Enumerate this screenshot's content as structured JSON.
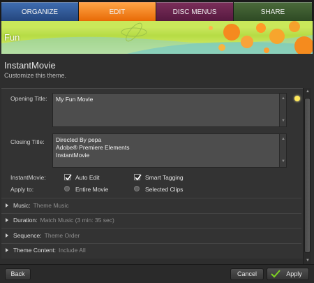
{
  "tabs": [
    "ORGANIZE",
    "EDIT",
    "DISC MENUS",
    "SHARE"
  ],
  "banner": {
    "title": "Fun"
  },
  "theme": {
    "name": "InstantMovie",
    "subtitle": "Customize this theme."
  },
  "opening_title": {
    "label": "Opening Title:",
    "value": "My Fun Movie"
  },
  "closing_title": {
    "label": "Closing Title:",
    "lines": [
      "Directed By pepa",
      "Adobe® Premiere Elements",
      "InstantMovie"
    ]
  },
  "instantmovie": {
    "label": "InstantMovie:",
    "auto_edit": {
      "label": "Auto Edit",
      "checked": true
    },
    "smart_tagging": {
      "label": "Smart Tagging",
      "checked": true
    }
  },
  "apply_to": {
    "label": "Apply to:",
    "entire_movie": "Entire Movie",
    "selected_clips": "Selected Clips"
  },
  "sections": [
    {
      "name": "Music:",
      "value": "Theme Music"
    },
    {
      "name": "Duration:",
      "value": "Match Music (3 min: 35 sec)"
    },
    {
      "name": "Sequence:",
      "value": "Theme Order"
    },
    {
      "name": "Theme Content:",
      "value": "Include All"
    }
  ],
  "footer": {
    "back": "Back",
    "cancel": "Cancel",
    "apply": "Apply"
  },
  "colors": {
    "edit_tab": "#f18a22",
    "apply_check": "#7ed321"
  }
}
